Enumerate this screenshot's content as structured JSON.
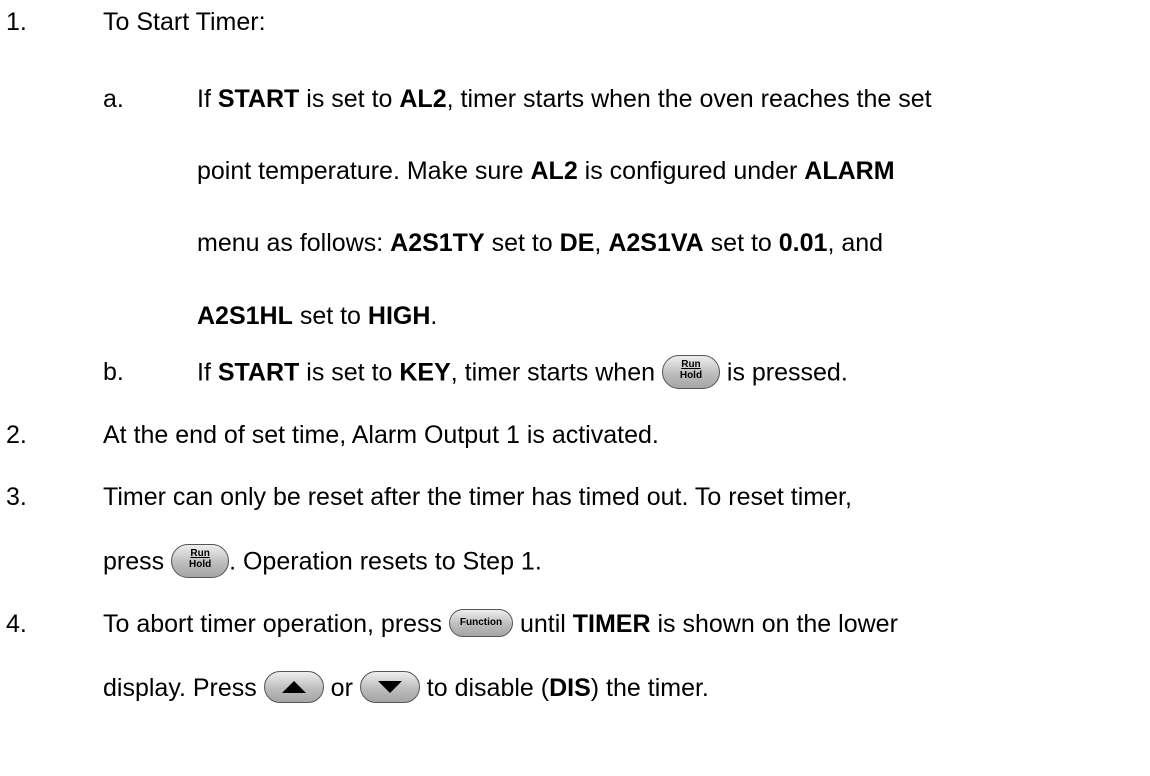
{
  "items": {
    "i1": {
      "num": "1.",
      "text": "To Start Timer:"
    },
    "ia": {
      "num": "a.",
      "l1": {
        "t1": "If ",
        "b1": "START",
        "t2": " is set to ",
        "b2": "AL2",
        "t3": ", timer starts when the oven reaches the set"
      },
      "l2": {
        "t1": "point temperature.  Make sure ",
        "b1": "AL2",
        "t2": " is configured under ",
        "b2": "ALARM"
      },
      "l3": {
        "t1": "menu as follows:  ",
        "b1": "A2S1TY",
        "t2": " set to ",
        "b2": "DE",
        "t3": ", ",
        "b3": "A2S1VA",
        "t4": " set to ",
        "b4": "0.01",
        "t5": ", and"
      },
      "l4": {
        "b1": "A2S1HL",
        "t1": " set to ",
        "b2": "HIGH",
        "t2": "."
      }
    },
    "ib": {
      "num": "b.",
      "t1": "If ",
      "b1": "START",
      "t2": " is set to ",
      "b2": "KEY",
      "t3": ", timer starts when ",
      "t4": " is pressed."
    },
    "i2": {
      "num": "2.",
      "text": "At the end of set time, Alarm Output 1 is activated."
    },
    "i3": {
      "num": "3.",
      "l1": "Timer can only be reset after the timer has timed out.  To reset timer,",
      "l2a": "press ",
      "l2b": ".  Operation resets to Step 1."
    },
    "i4": {
      "num": "4.",
      "l1a": "To abort timer operation, press ",
      "l1b": " until ",
      "l1c": "TIMER",
      "l1d": " is shown on the lower",
      "l2a": "display.  Press ",
      "l2b": " or ",
      "l2c": " to disable (",
      "l2d": "DIS",
      "l2e": ") the timer."
    }
  },
  "keys": {
    "run_hold": {
      "top": "Run",
      "bottom": "Hold"
    },
    "function": {
      "label": "Function"
    },
    "up_icon": "up-arrow-icon",
    "down_icon": "down-arrow-icon"
  }
}
